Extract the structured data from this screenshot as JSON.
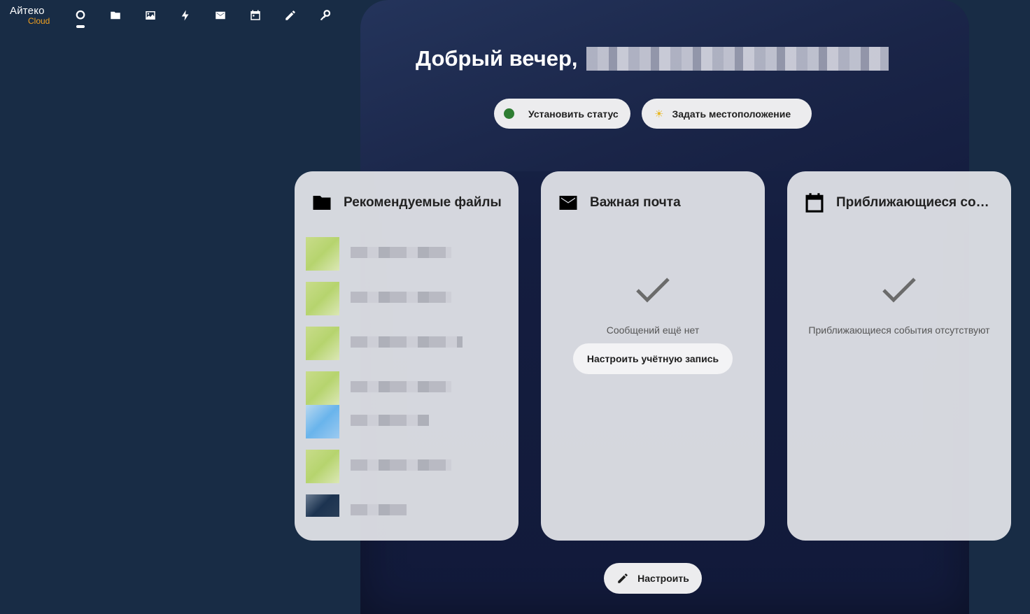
{
  "brand": {
    "name": "Айтеко",
    "sub": "Cloud",
    "sub_color": "#f0a020"
  },
  "nav": {
    "items": [
      {
        "name": "dashboard-icon",
        "active": true
      },
      {
        "name": "files-icon"
      },
      {
        "name": "photos-icon"
      },
      {
        "name": "activity-icon"
      },
      {
        "name": "mail-icon"
      },
      {
        "name": "calendar-icon"
      },
      {
        "name": "notes-icon"
      },
      {
        "name": "passwords-icon"
      }
    ]
  },
  "greeting": {
    "text": "Добрый вечер,"
  },
  "actions": {
    "set_status": "Установить статус",
    "set_location": "Задать местоположение",
    "status_color": "#2e7d32"
  },
  "widgets": {
    "files": {
      "title": "Рекомендуемые файлы",
      "icon": "folder-icon",
      "item_count": 7
    },
    "mail": {
      "title": "Важная почта",
      "icon": "mail-icon",
      "empty_text": "Сообщений ещё нет",
      "setup_label": "Настроить учётную запись"
    },
    "calendar": {
      "title": "Приближающиеся события",
      "icon": "calendar-icon",
      "empty_text": "Приближающиеся события отсутствуют"
    }
  },
  "customize": {
    "label": "Настроить"
  }
}
